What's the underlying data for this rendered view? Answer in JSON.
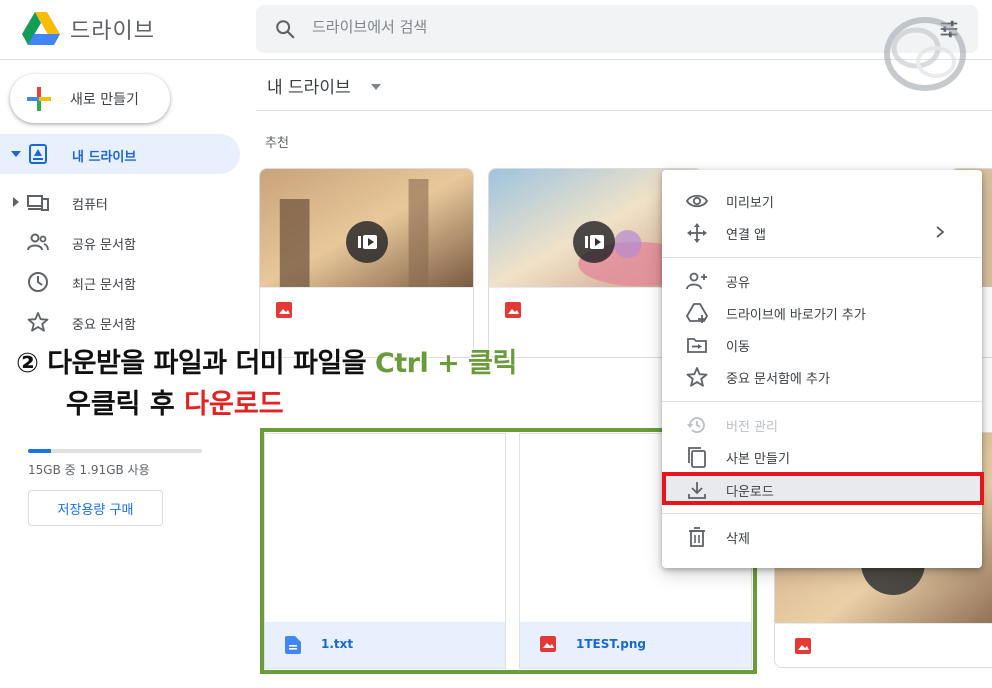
{
  "header": {
    "app_title": "드라이브",
    "search_placeholder": "드라이브에서 검색"
  },
  "sidebar": {
    "new_label": "새로 만들기",
    "items": [
      {
        "label": "내 드라이브",
        "icon": "my-drive-icon",
        "active": true
      },
      {
        "label": "컴퓨터",
        "icon": "computer-icon"
      },
      {
        "label": "공유 문서함",
        "icon": "shared-icon"
      },
      {
        "label": "최근 문서함",
        "icon": "clock-icon"
      },
      {
        "label": "중요 문서함",
        "icon": "star-icon"
      }
    ],
    "storage_text": "15GB 중 1.91GB 사용",
    "storage_fraction": 0.13,
    "buy_label": "저장용량 구매"
  },
  "main": {
    "breadcrumb": "내 드라이브",
    "section_title": "추천",
    "files": [
      {
        "name": "1.txt",
        "icon": "doc-icon"
      },
      {
        "name": "1TEST.png",
        "icon": "image-icon"
      }
    ]
  },
  "annotation": {
    "line1_a": "② 다운받을 파일과 더미 파일을 ",
    "line1_b": "Ctrl + 클릭",
    "line2_a": "우클릭 후 ",
    "line2_b": "다운로드"
  },
  "context_menu": {
    "items": [
      {
        "label": "미리보기",
        "icon": "eye-icon"
      },
      {
        "label": "연결 앱",
        "icon": "move-arrows-icon",
        "submenu": true
      },
      {
        "label": "공유",
        "icon": "person-add-icon"
      },
      {
        "label": "드라이브에 바로가기 추가",
        "icon": "drive-shortcut-icon"
      },
      {
        "label": "이동",
        "icon": "move-to-icon"
      },
      {
        "label": "중요 문서함에 추가",
        "icon": "star-icon"
      },
      {
        "label": "버전 관리",
        "icon": "history-icon",
        "disabled": true
      },
      {
        "label": "사본 만들기",
        "icon": "copy-icon"
      },
      {
        "label": "다운로드",
        "icon": "download-icon",
        "highlighted": true
      },
      {
        "label": "삭제",
        "icon": "trash-icon"
      }
    ]
  },
  "colors": {
    "accent": "#1a73e8",
    "annotation_green": "#6a9c3a",
    "annotation_red": "#e32222"
  }
}
